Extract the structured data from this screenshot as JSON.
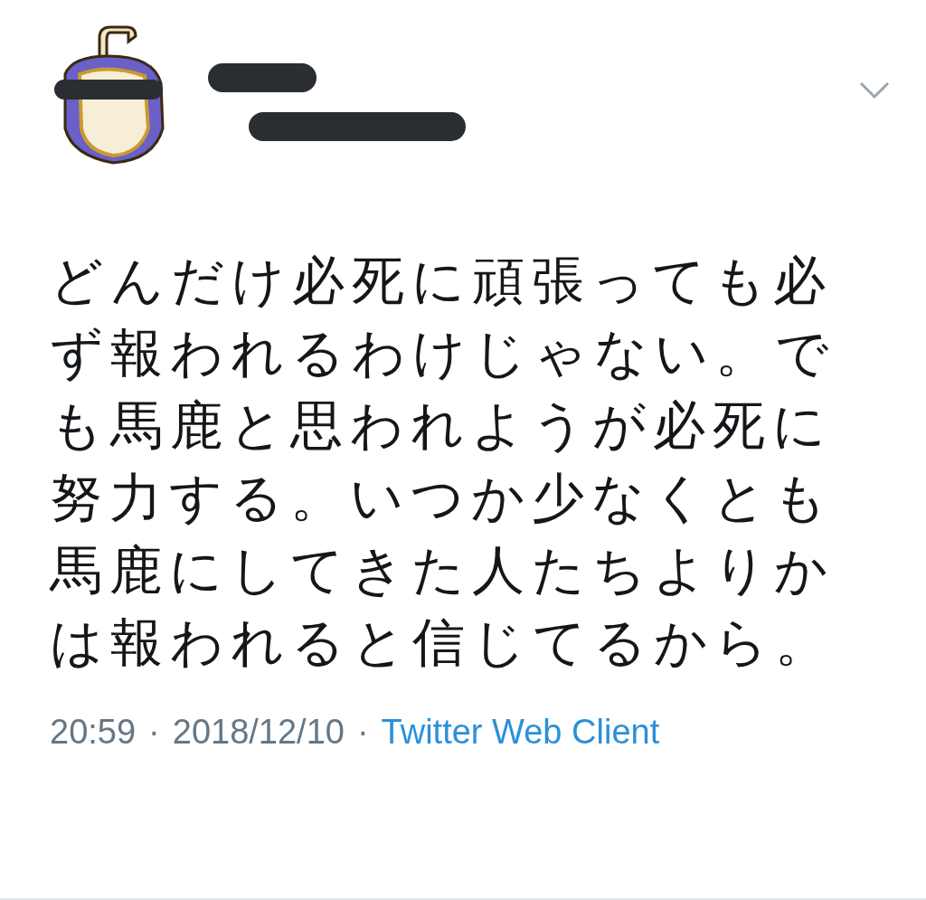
{
  "tweet": {
    "text": "どんだけ必死に頑張っても必ず報われるわけじゃない。でも馬鹿と思われようが必死に努力する。いつか少なくとも馬鹿にしてきた人たちよりかは報われると信じてるから。",
    "time": "20:59",
    "date": "2018/12/10",
    "separator": "·",
    "client": "Twitter Web Client"
  }
}
